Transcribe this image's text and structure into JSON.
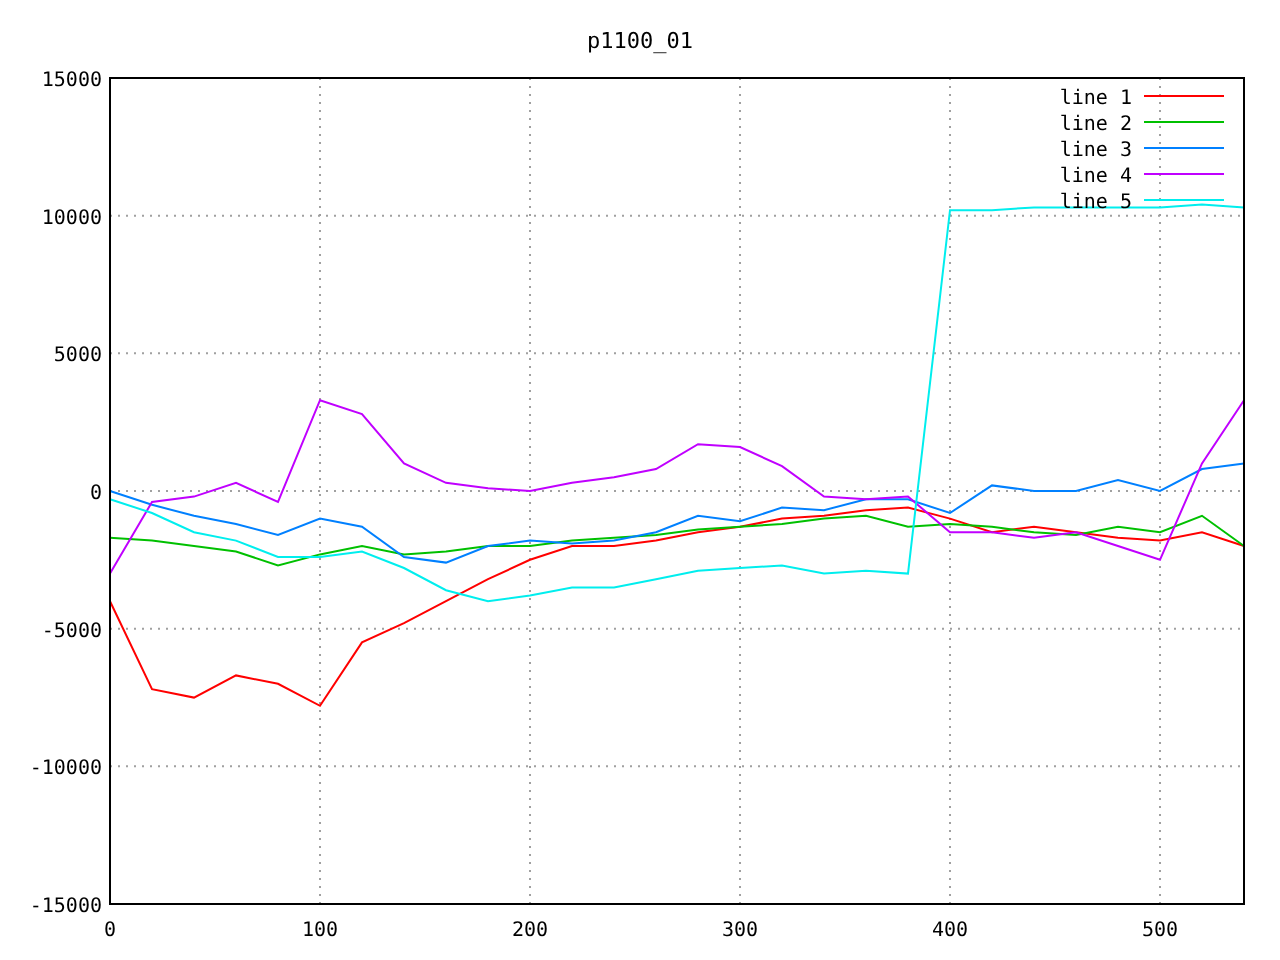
{
  "chart": {
    "chart_data": {
      "type": "line",
      "title": "p1100_01",
      "x": [
        0,
        20,
        40,
        60,
        80,
        100,
        120,
        140,
        160,
        180,
        200,
        220,
        240,
        260,
        280,
        300,
        320,
        340,
        360,
        380,
        400,
        420,
        440,
        460,
        480,
        500,
        520,
        540
      ],
      "xlim": [
        0,
        540
      ],
      "ylim": [
        -15000,
        15000
      ],
      "xticks": [
        0,
        100,
        200,
        300,
        400,
        500
      ],
      "yticks": [
        -15000,
        -10000,
        -5000,
        0,
        5000,
        10000,
        15000
      ],
      "grid": true,
      "legend": true,
      "series": [
        {
          "name": "line 1",
          "color": "#ff0000",
          "values": [
            -4000,
            -7200,
            -7500,
            -6700,
            -7000,
            -7800,
            -5500,
            -4800,
            -4000,
            -3200,
            -2500,
            -2000,
            -2000,
            -1800,
            -1500,
            -1300,
            -1000,
            -900,
            -700,
            -600,
            -1000,
            -1500,
            -1300,
            -1500,
            -1700,
            -1800,
            -1500,
            -2000
          ]
        },
        {
          "name": "line 2",
          "color": "#00c000",
          "values": [
            -1700,
            -1800,
            -2000,
            -2200,
            -2700,
            -2300,
            -2000,
            -2300,
            -2200,
            -2000,
            -2000,
            -1800,
            -1700,
            -1600,
            -1400,
            -1300,
            -1200,
            -1000,
            -900,
            -1300,
            -1200,
            -1300,
            -1500,
            -1600,
            -1300,
            -1500,
            -900,
            -2000
          ]
        },
        {
          "name": "line 3",
          "color": "#0080ff",
          "values": [
            0,
            -500,
            -900,
            -1200,
            -1600,
            -1000,
            -1300,
            -2400,
            -2600,
            -2000,
            -1800,
            -1900,
            -1800,
            -1500,
            -900,
            -1100,
            -600,
            -700,
            -300,
            -300,
            -800,
            200,
            0,
            0,
            400,
            0,
            800,
            1000
          ]
        },
        {
          "name": "line 4",
          "color": "#c000ff",
          "values": [
            -3000,
            -400,
            -200,
            300,
            -400,
            3300,
            2800,
            1000,
            300,
            100,
            0,
            300,
            500,
            800,
            1700,
            1600,
            900,
            -200,
            -300,
            -200,
            -1500,
            -1500,
            -1700,
            -1500,
            -2000,
            -2500,
            1000,
            3300
          ]
        },
        {
          "name": "line 5",
          "color": "#00eeee",
          "values": [
            -300,
            -800,
            -1500,
            -1800,
            -2400,
            -2400,
            -2200,
            -2800,
            -3600,
            -4000,
            -3800,
            -3500,
            -3500,
            -3200,
            -2900,
            -2800,
            -2700,
            -3000,
            -2900,
            -3000,
            10200,
            10200,
            10300,
            10300,
            10300,
            10300,
            10400,
            10300
          ]
        }
      ]
    }
  }
}
